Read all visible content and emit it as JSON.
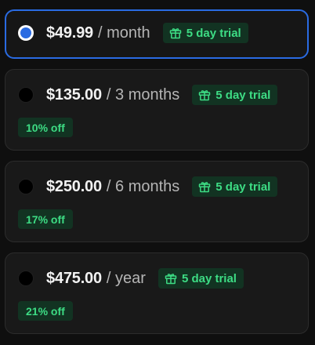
{
  "plans": [
    {
      "price": "$49.99",
      "period": "/ month",
      "trial": "5 day trial",
      "discount": null,
      "selected": true
    },
    {
      "price": "$135.00",
      "period": "/ 3 months",
      "trial": "5 day trial",
      "discount": "10% off",
      "selected": false
    },
    {
      "price": "$250.00",
      "period": "/ 6 months",
      "trial": "5 day trial",
      "discount": "17% off",
      "selected": false
    },
    {
      "price": "$475.00",
      "period": "/ year",
      "trial": "5 day trial",
      "discount": "21% off",
      "selected": false
    }
  ],
  "colors": {
    "accent_blue": "#2a6be2",
    "badge_green_text": "#3ddc84",
    "badge_green_bg": "#123322",
    "card_bg": "#191919",
    "page_bg": "#0f0f0f"
  },
  "icons": {
    "trial": "gift-icon"
  }
}
